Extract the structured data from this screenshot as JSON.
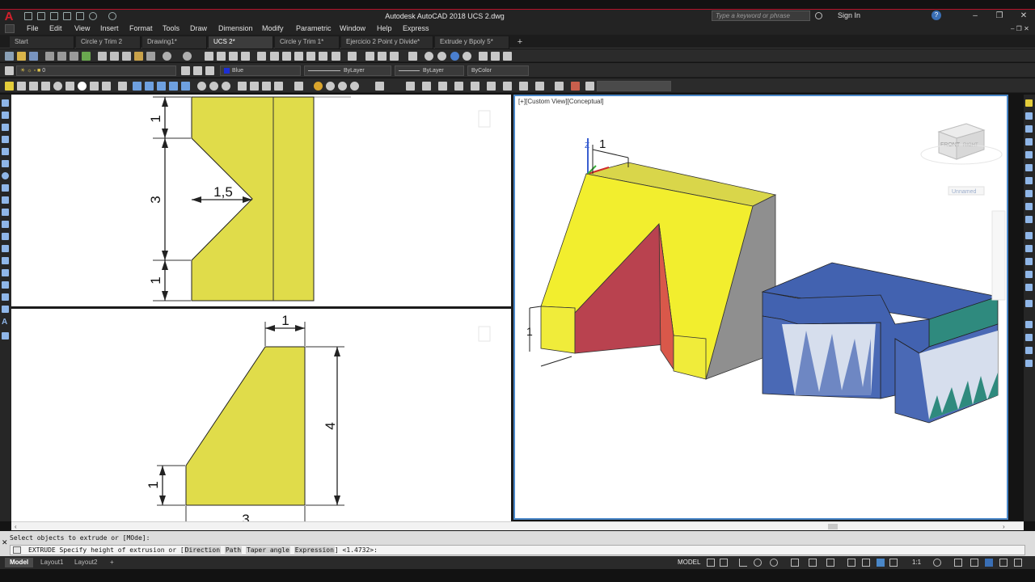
{
  "app": {
    "title": "Autodesk AutoCAD 2018   UCS 2.dwg",
    "logo": "A",
    "search_placeholder": "Type a keyword or phrase",
    "signin_label": "Sign In",
    "window_controls": [
      "–",
      "❐",
      "✕"
    ]
  },
  "menu": [
    "File",
    "Edit",
    "View",
    "Insert",
    "Format",
    "Tools",
    "Draw",
    "Dimension",
    "Modify",
    "Parametric",
    "Window",
    "Help",
    "Express"
  ],
  "tabs": [
    {
      "label": "Start",
      "active": false
    },
    {
      "label": "Circle y Trim 2",
      "active": false
    },
    {
      "label": "Drawing1*",
      "active": false
    },
    {
      "label": "UCS 2*",
      "active": true
    },
    {
      "label": "Circle y Trim 1*",
      "active": false
    },
    {
      "label": "Ejercicio 2 Point y Divide*",
      "active": false
    },
    {
      "label": "Extrude y Bpoly 5*",
      "active": false
    }
  ],
  "properties_bar": {
    "layer_value": "0",
    "color_value": "Blue",
    "linetype_value": "ByLayer",
    "lineweight_value": "ByLayer",
    "plotstyle_value": "ByColor"
  },
  "viewports": {
    "active_label": "[+][Custom View][Conceptual]",
    "viewcube_front": "FRONT",
    "viewcube_right": "RIGHT",
    "viewcube_ucs": "Unnamed",
    "top_left_dims": {
      "top": "1",
      "middle": "3",
      "bottom": "1",
      "depth": "1,5"
    },
    "bottom_left_dims": {
      "top": "1",
      "height": "4",
      "left": "1",
      "bottom": "3"
    },
    "active_dim": "1",
    "active_small_dim": "1"
  },
  "colors": {
    "yellow_face": "#f2ee2e",
    "yellow_side": "#d7d44a",
    "gray_face": "#8d8d8d",
    "red_face": "#b9424f",
    "blue_face": "#4262b0",
    "teal_face": "#2f8a7e",
    "viewport_border": "#4a87c8"
  },
  "command": {
    "history": "Select objects to extrude or [MOde]:",
    "prompt_prefix": "EXTRUDE Specify height of extrusion or [",
    "options": [
      "Direction",
      "Path",
      "Taper angle",
      "Expression"
    ],
    "prompt_suffix": "] <1.4732>:"
  },
  "status": {
    "layout_tabs": [
      "Model",
      "Layout1",
      "Layout2"
    ],
    "add_tab": "+",
    "model_label": "MODEL",
    "scale": "1:1"
  }
}
